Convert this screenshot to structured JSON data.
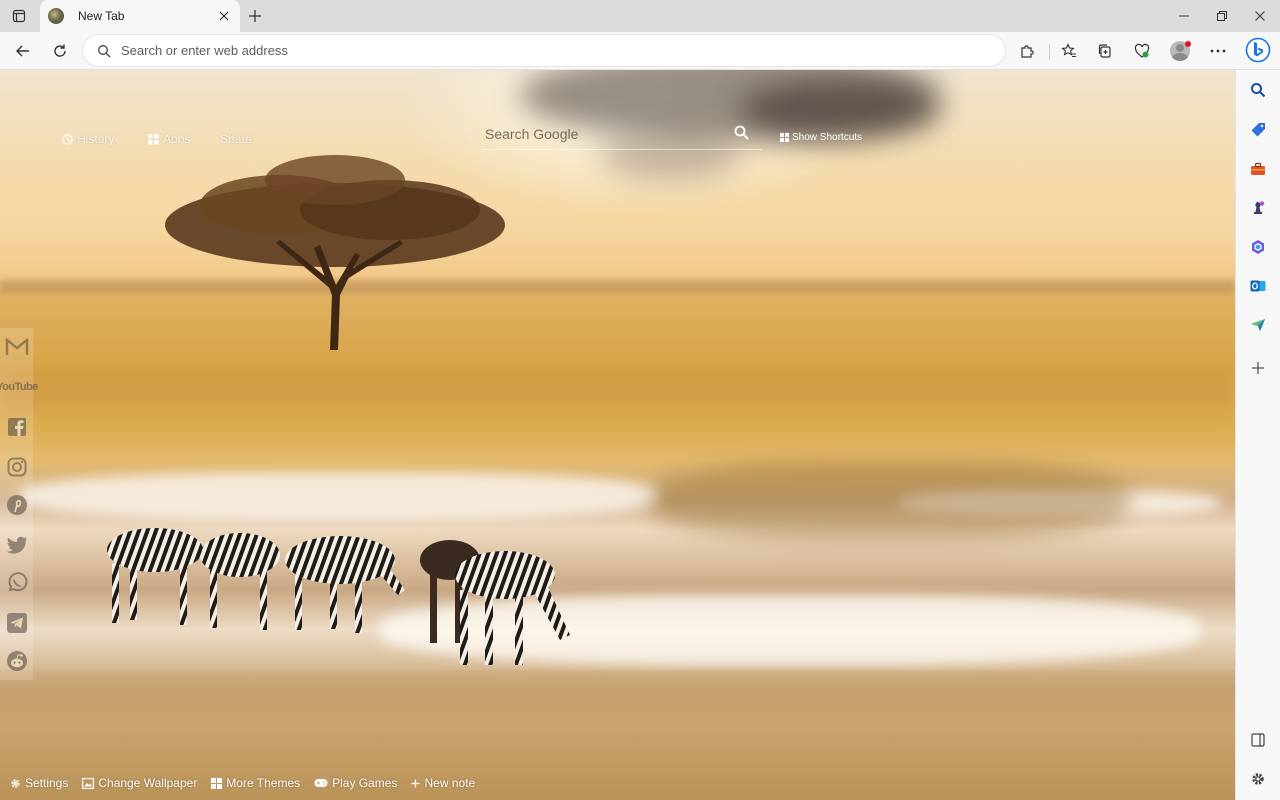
{
  "browser": {
    "tab": {
      "title": "New Tab"
    },
    "address_bar": {
      "placeholder": "Search or enter web address"
    }
  },
  "newtab": {
    "top_links": [
      {
        "label": "History",
        "icon": "history-icon"
      },
      {
        "label": "Apps",
        "icon": "apps-icon"
      },
      {
        "label": "Share",
        "icon": ""
      }
    ],
    "search": {
      "placeholder": "Search Google"
    },
    "shortcuts_label": "Show Shortcuts",
    "social_sidebar": [
      "gmail-icon",
      "youtube-icon",
      "facebook-icon",
      "instagram-icon",
      "pinterest-icon",
      "twitter-icon",
      "whatsapp-icon",
      "telegram-icon",
      "reddit-icon"
    ],
    "youtube_text": "YouTube",
    "bottom_links": [
      {
        "label": "Settings",
        "icon": "gear-icon"
      },
      {
        "label": "Change Wallpaper",
        "icon": "picture-icon"
      },
      {
        "label": "More Themes",
        "icon": "grid-icon"
      },
      {
        "label": "Play Games",
        "icon": "gamepad-icon"
      },
      {
        "label": "New note",
        "icon": "plus-icon"
      }
    ]
  },
  "colors": {
    "edge_blue": "#1a73e8",
    "outlook_blue": "#0f6cbd",
    "accent_red": "#e81123"
  }
}
